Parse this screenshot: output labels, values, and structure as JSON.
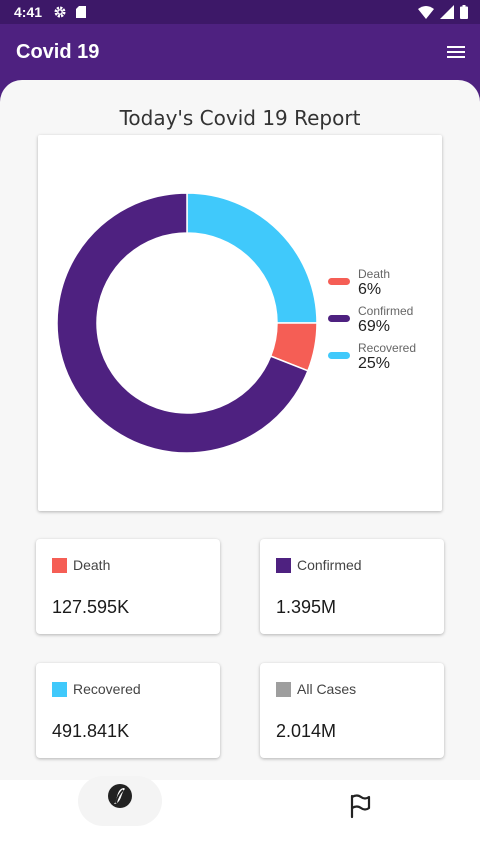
{
  "status_bar": {
    "time": "4:41"
  },
  "app_bar": {
    "title": "Covid 19",
    "menu_icon": "menu-icon"
  },
  "report": {
    "title": "Today's Covid 19 Report"
  },
  "chart_data": {
    "type": "pie",
    "categories": [
      "Death",
      "Confirmed",
      "Recovered"
    ],
    "values": [
      6,
      69,
      25
    ],
    "labels": [
      "6%",
      "69%",
      "25%"
    ],
    "colors": [
      "#f55e55",
      "#4e2180",
      "#40c9fb"
    ],
    "legend": "right"
  },
  "stats": [
    {
      "label": "Death",
      "value": "127.595K",
      "color": "#f55e55"
    },
    {
      "label": "Confirmed",
      "value": "1.395M",
      "color": "#4e2180"
    },
    {
      "label": "Recovered",
      "value": "491.841K",
      "color": "#40c9fb"
    },
    {
      "label": "All Cases",
      "value": "2.014M",
      "color": "#9e9e9e"
    }
  ],
  "bottom_nav": {
    "items": [
      "home-icon",
      "flag-icon"
    ]
  }
}
